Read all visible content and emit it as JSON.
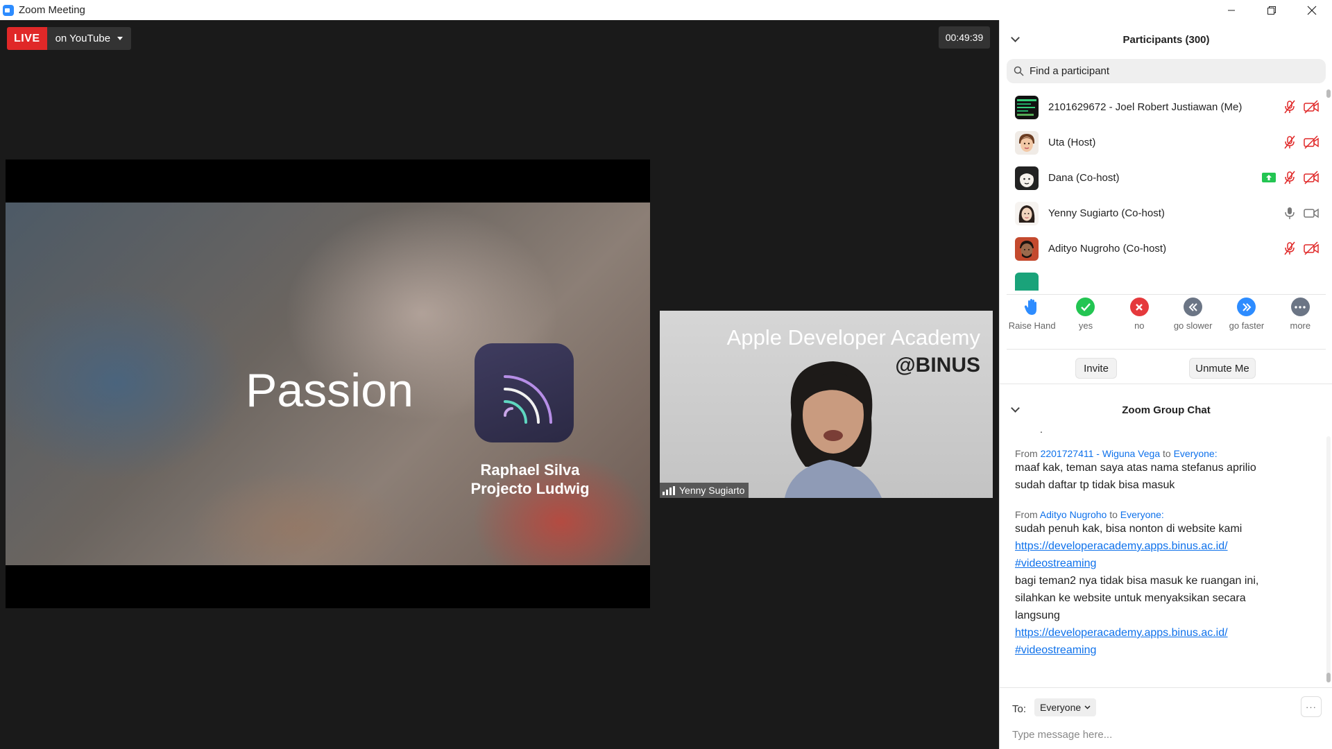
{
  "window": {
    "title": "Zoom Meeting"
  },
  "live": {
    "badge": "LIVE",
    "destination": "on YouTube"
  },
  "timer": "00:49:39",
  "slide": {
    "heading": "Passion",
    "presenter_name": "Raphael Silva",
    "presenter_project": "Projecto Ludwig"
  },
  "speaker": {
    "brand_line1": "Apple Developer Academy",
    "brand_line2": "@BINUS",
    "name": "Yenny Sugiarto"
  },
  "participants": {
    "title": "Participants (300)",
    "search_placeholder": "Find a participant",
    "list": [
      {
        "name": "2101629672 - Joel Robert Justiawan (Me)",
        "muted": true,
        "video_off": true,
        "sharing": false
      },
      {
        "name": "Uta (Host)",
        "muted": true,
        "video_off": true,
        "sharing": false
      },
      {
        "name": "Dana (Co-host)",
        "muted": true,
        "video_off": true,
        "sharing": true
      },
      {
        "name": "Yenny Sugiarto (Co-host)",
        "muted": false,
        "video_off": false,
        "sharing": false
      },
      {
        "name": "Adityo Nugroho (Co-host)",
        "muted": true,
        "video_off": true,
        "sharing": false
      }
    ]
  },
  "reactions": [
    {
      "label": "Raise Hand",
      "icon": "raise-hand-icon",
      "color": "#2d8cff"
    },
    {
      "label": "yes",
      "icon": "check-icon",
      "color": "#23c552"
    },
    {
      "label": "no",
      "icon": "x-icon",
      "color": "#e5393c"
    },
    {
      "label": "go slower",
      "icon": "rewind-icon",
      "color": "#6b7585"
    },
    {
      "label": "go faster",
      "icon": "fast-forward-icon",
      "color": "#2d8cff"
    },
    {
      "label": "more",
      "icon": "ellipsis-icon",
      "color": "#6b7585"
    }
  ],
  "actions": {
    "invite": "Invite",
    "unmute": "Unmute Me"
  },
  "chat": {
    "title": "Zoom Group Chat",
    "messages": [
      {
        "from_prefix": "From",
        "sender": "2201727411 - Wiguna Vega",
        "to_word": "to",
        "recipient": "Everyone:",
        "lines": [
          "maaf kak, teman saya atas nama stefanus aprilio",
          "sudah daftar tp tidak bisa masuk"
        ]
      },
      {
        "from_prefix": "From",
        "sender": "Adityo Nugroho",
        "to_word": "to",
        "recipient": "Everyone:",
        "line1": "sudah penuh kak, bisa nonton di website kami",
        "link1a": "https://developeracademy.apps.binus.ac.id/",
        "link1b": "#videostreaming",
        "line2": "bagi teman2 nya tidak bisa masuk ke ruangan ini,",
        "line3": "silahkan ke website untuk menyaksikan secara",
        "line4": "langsung",
        "link2a": "https://developeracademy.apps.binus.ac.id/",
        "link2b": "#videostreaming"
      }
    ],
    "to_label": "To:",
    "to_value": "Everyone",
    "more_label": "···",
    "input_placeholder": "Type message here..."
  }
}
